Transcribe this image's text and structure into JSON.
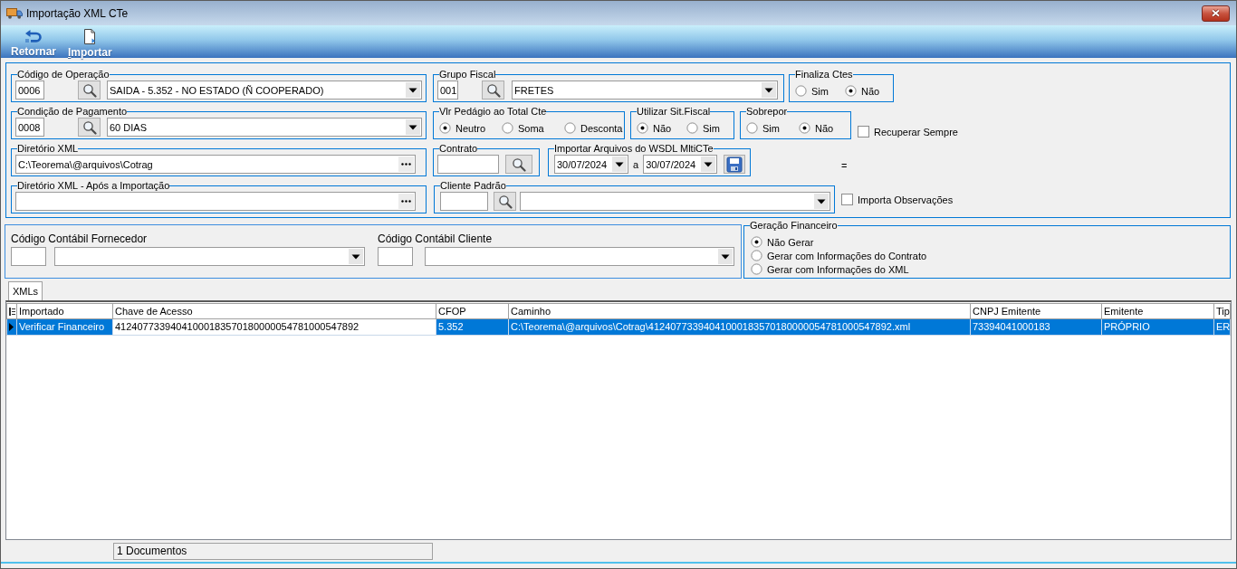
{
  "window": {
    "title": "Importação XML CTe"
  },
  "toolbar": {
    "buttons": [
      {
        "label": "Retornar",
        "kind": "back",
        "hotkey_underlined": false
      },
      {
        "label": "Importar",
        "kind": "import",
        "hotkey_underlined": true
      }
    ]
  },
  "form": {
    "operation_code": {
      "legend": "Código de Operação",
      "code": "0006",
      "value": "SAIDA - 5.352 - NO ESTADO (Ñ COOPERADO)"
    },
    "fiscal_group": {
      "legend": "Grupo Fiscal",
      "code": "001",
      "value": "FRETES"
    },
    "finalize_ctes": {
      "legend": "Finaliza Ctes",
      "options": [
        {
          "label": "Sim",
          "selected": false
        },
        {
          "label": "Não",
          "selected": true
        }
      ]
    },
    "payment_condition": {
      "legend": "Condição de Pagamento",
      "code": "0008",
      "value": "60 DIAS"
    },
    "toll_to_cte_total": {
      "legend": "Vlr Pedágio ao Total Cte",
      "options": [
        {
          "label": "Neutro",
          "selected": true
        },
        {
          "label": "Soma",
          "selected": false
        },
        {
          "label": "Desconta",
          "selected": false
        }
      ]
    },
    "use_fiscal_status": {
      "legend": "Utilizar Sit.Fiscal",
      "options": [
        {
          "label": "Não",
          "selected": true
        },
        {
          "label": "Sim",
          "selected": false
        }
      ]
    },
    "overwrite": {
      "legend": "Sobrepor",
      "options": [
        {
          "label": "Sim",
          "selected": false
        },
        {
          "label": "Não",
          "selected": true
        }
      ]
    },
    "always_recover": {
      "label": "Recuperar Sempre",
      "checked": false
    },
    "xml_directory": {
      "legend": "Diretório XML",
      "value": "C:\\Teorema\\@arquivos\\Cotrag"
    },
    "contract": {
      "legend": "Contrato"
    },
    "wsdl_import": {
      "legend": "Importar Arquivos do WSDL MltiCTe",
      "from": "30/07/2024",
      "separator": "a",
      "to": "30/07/2024"
    },
    "note": "=",
    "after_import_directory": {
      "legend": "Diretório XML - Após a Importação"
    },
    "default_client": {
      "legend": "Cliente Padrão"
    },
    "import_notes": {
      "label": "Importa Observações",
      "checked": false
    }
  },
  "accounting": {
    "supplier": {
      "label": "Código Contábil Fornecedor"
    },
    "client": {
      "label": "Código Contábil Cliente"
    }
  },
  "financial_generation": {
    "legend": "Geração Financeiro",
    "options": [
      {
        "label": "Não Gerar",
        "selected": true
      },
      {
        "label": "Gerar com Informações do Contrato",
        "selected": false
      },
      {
        "label": "Gerar com Informações do XML",
        "selected": false
      }
    ]
  },
  "tabs": [
    {
      "label": "XMLs",
      "selected": true
    }
  ],
  "table": {
    "columns": [
      "Importado",
      "Chave de Acesso",
      "CFOP",
      "Caminho",
      "CNPJ Emitente",
      "Emitente",
      "Tip"
    ],
    "rows": [
      {
        "selected": true,
        "current": true,
        "cells": [
          {
            "text": "Verificar Financeiro",
            "focused": false
          },
          {
            "text": "41240773394041000183570180000054781000547892",
            "focused": true
          },
          {
            "text": "5.352",
            "focused": false
          },
          {
            "text": "C:\\Teorema\\@arquivos\\Cotrag\\41240773394041000183570180000054781000547892.xml",
            "focused": false
          },
          {
            "text": "73394041000183",
            "focused": false
          },
          {
            "text": "PRÓPRIO",
            "focused": false
          },
          {
            "text": "ER",
            "focused": false
          }
        ]
      }
    ]
  },
  "status_bar": {
    "count": "1 Documentos"
  }
}
